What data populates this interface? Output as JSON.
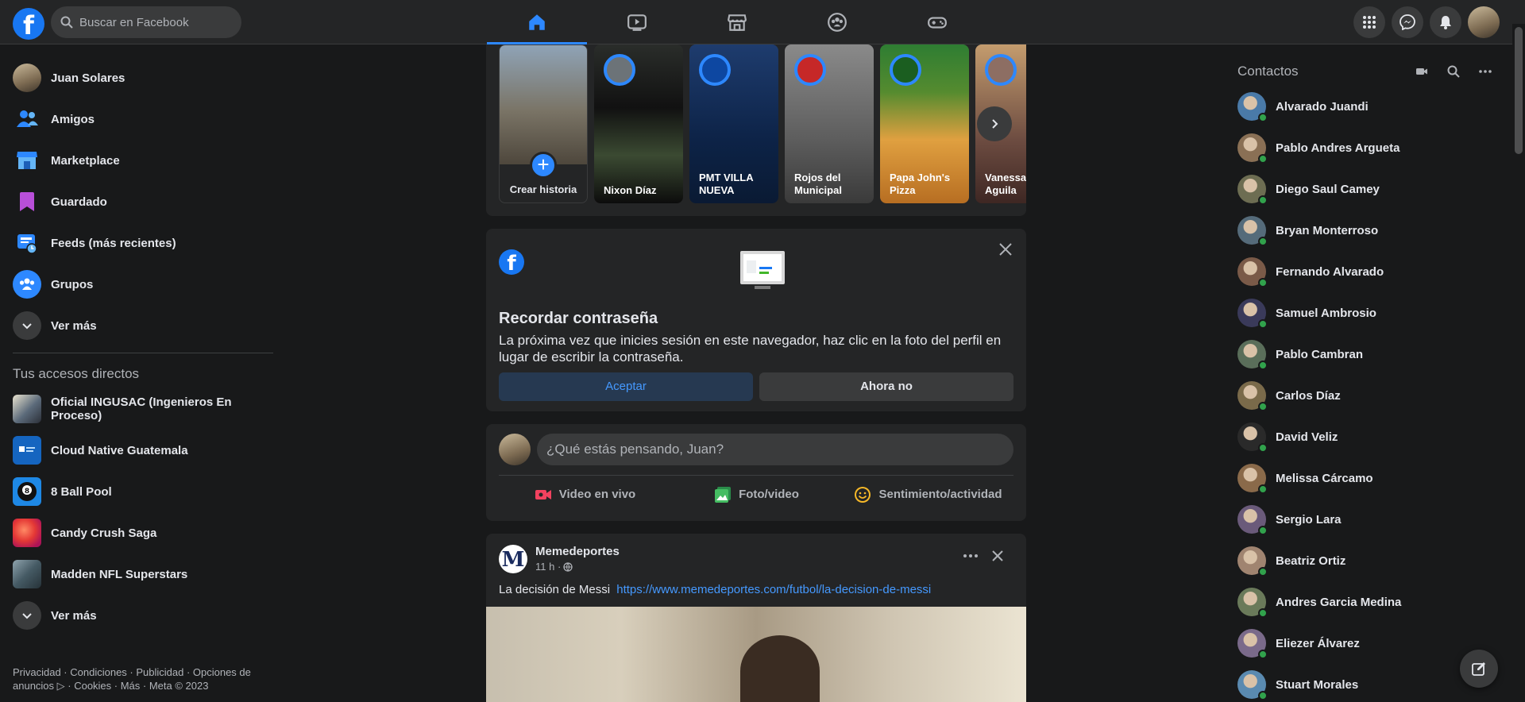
{
  "brand": {
    "accent": "#2d88ff",
    "online": "#31a24c"
  },
  "search": {
    "placeholder": "Buscar en Facebook"
  },
  "navtabs": [
    {
      "icon": "home-icon",
      "active": true
    },
    {
      "icon": "video-icon",
      "active": false
    },
    {
      "icon": "marketplace-icon",
      "active": false
    },
    {
      "icon": "groups-icon",
      "active": false
    },
    {
      "icon": "gaming-icon",
      "active": false
    }
  ],
  "sidebar": {
    "items": [
      {
        "label": "Juan Solares",
        "icon": "avatar"
      },
      {
        "label": "Amigos",
        "icon": "friends-icon"
      },
      {
        "label": "Marketplace",
        "icon": "marketplace-icon"
      },
      {
        "label": "Guardado",
        "icon": "bookmark-icon"
      },
      {
        "label": "Feeds (más recientes)",
        "icon": "feeds-icon"
      },
      {
        "label": "Grupos",
        "icon": "groups-icon"
      },
      {
        "label": "Ver más",
        "icon": "chevron-down-icon"
      }
    ],
    "shortcuts_heading": "Tus accesos directos",
    "shortcuts": [
      {
        "label": "Oficial INGUSAC (Ingenieros En Proceso)"
      },
      {
        "label": "Cloud Native Guatemala"
      },
      {
        "label": "8 Ball Pool"
      },
      {
        "label": "Candy Crush Saga"
      },
      {
        "label": "Madden NFL Superstars"
      },
      {
        "label": "Ver más"
      }
    ],
    "footer": "Privacidad · Condiciones · Publicidad · Opciones de anuncios ▷ · Cookies · Más · Meta © 2023"
  },
  "stories": [
    {
      "name": "Crear historia"
    },
    {
      "name": "Nixon Díaz"
    },
    {
      "name": "PMT VILLA NUEVA"
    },
    {
      "name": "Rojos del Municipal"
    },
    {
      "name": "Papa John's Pizza"
    },
    {
      "name": "Vanessa Aguila"
    }
  ],
  "password_card": {
    "title": "Recordar contraseña",
    "body": "La próxima vez que inicies sesión en este navegador, haz clic en la foto del perfil en lugar de escribir la contraseña.",
    "accept": "Aceptar",
    "decline": "Ahora no"
  },
  "composer": {
    "placeholder": "¿Qué estás pensando, Juan?",
    "actions": [
      "Video en vivo",
      "Foto/video",
      "Sentimiento/actividad"
    ]
  },
  "post": {
    "author": "Memedeportes",
    "time": "11 h ·",
    "text": "La decisión de Messi",
    "link": "https://www.memedeportes.com/futbol/la-decision-de-messi"
  },
  "contacts": {
    "title": "Contactos",
    "list": [
      "Alvarado Juandi",
      "Pablo Andres Argueta",
      "Diego Saul Camey",
      "Bryan Monterroso",
      "Fernando Alvarado",
      "Samuel Ambrosio",
      "Pablo Cambran",
      "Carlos Díaz",
      "David Veliz",
      "Melissa Cárcamo",
      "Sergio Lara",
      "Beatriz Ortiz",
      "Andres Garcia Medina",
      "Eliezer Álvarez",
      "Stuart Morales"
    ]
  }
}
